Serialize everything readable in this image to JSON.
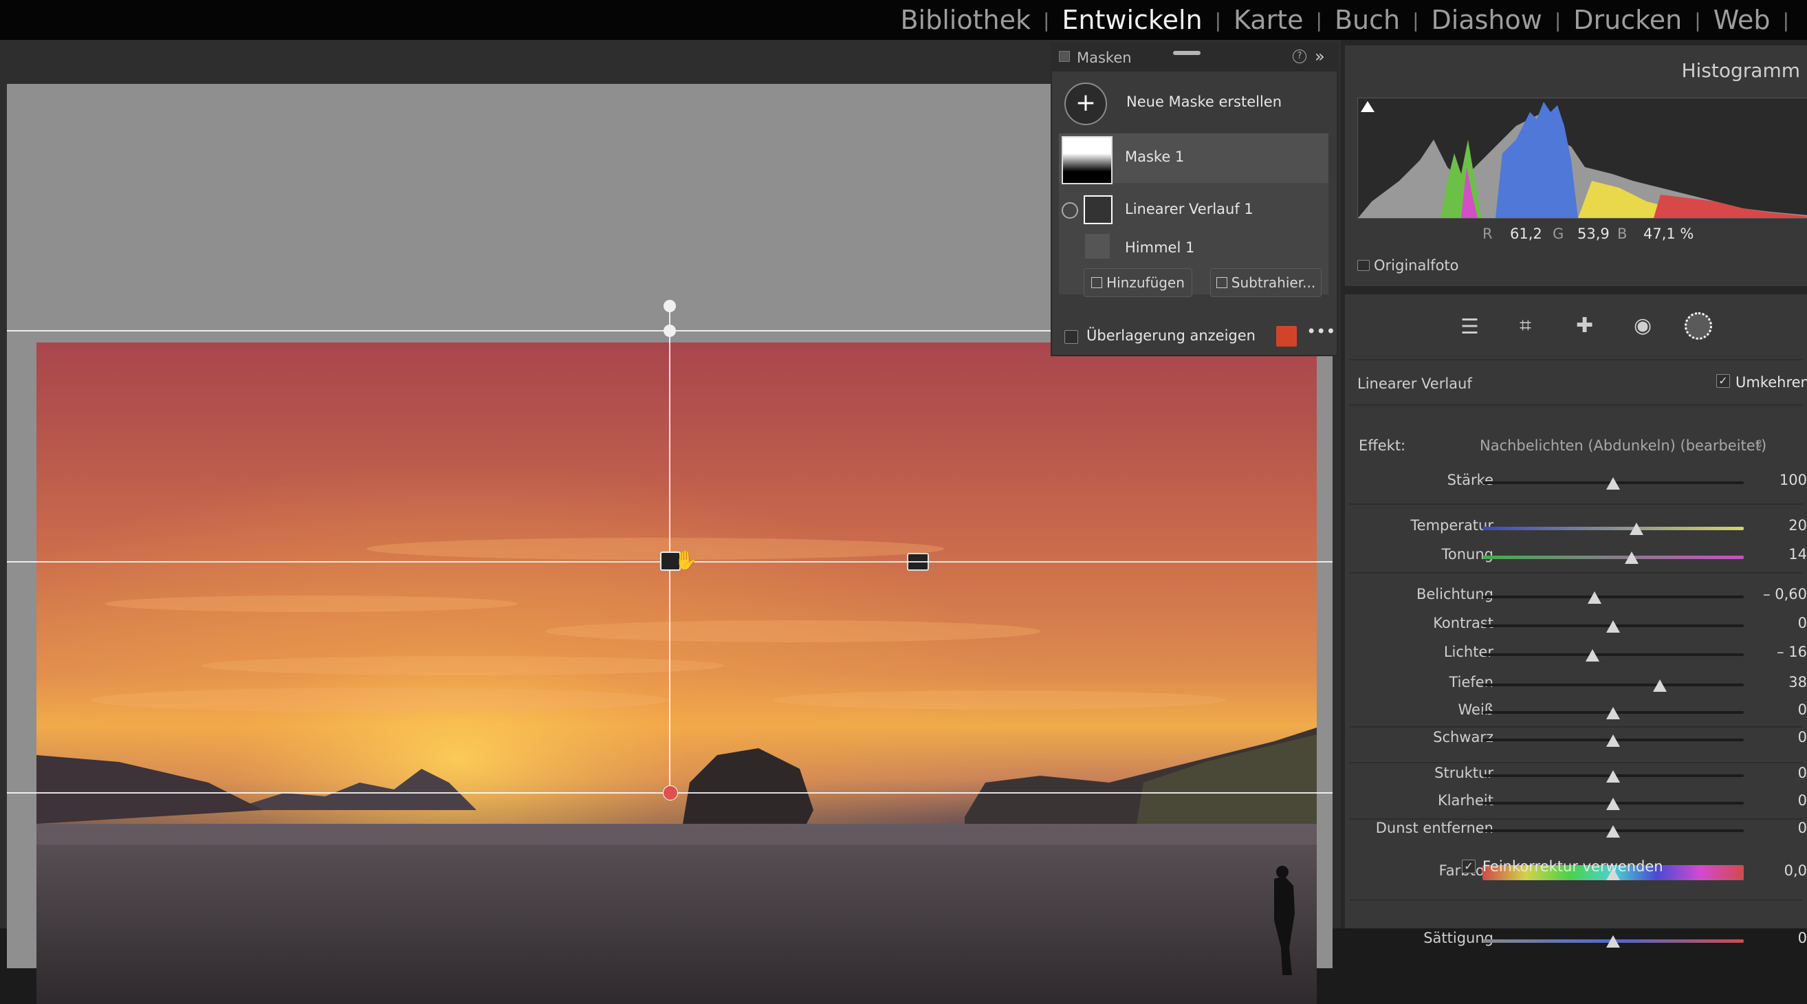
{
  "modules": [
    "Bibliothek",
    "Entwickeln",
    "Karte",
    "Buch",
    "Diashow",
    "Drucken",
    "Web"
  ],
  "active_module": "Entwickeln",
  "mask_panel": {
    "title": "Masken",
    "new_mask": "Neue Maske erstellen",
    "mask_name": "Maske 1",
    "component_1": "Linearer Verlauf 1",
    "component_2": "Himmel 1",
    "add_button": "Hinzufügen",
    "subtract_button": "Subtrahier...",
    "overlay_label": "Überlagerung anzeigen",
    "overlay_color": "#d2442a"
  },
  "histogram": {
    "title": "Histogramm",
    "r_label": "R",
    "r_value": "61,2",
    "g_label": "G",
    "g_value": "53,9",
    "b_label": "B",
    "b_value": "47,1 %",
    "original_label": "Originalfoto"
  },
  "tool_panel": {
    "section_title": "Linearer Verlauf",
    "invert_label": "Umkehren",
    "effect_label": "Effekt:",
    "effect_value": "Nachbelichten (Abdunkeln) (bearbeitet)",
    "fine_label": "Feinkorrektur verwenden"
  },
  "sliders": [
    {
      "label": "Stärke",
      "value": "100",
      "pos": 0.5
    },
    {
      "label": "Temperatur",
      "value": "20",
      "pos": 0.59
    },
    {
      "label": "Tonung",
      "value": "14",
      "pos": 0.57
    },
    {
      "label": "Belichtung",
      "value": "– 0,60",
      "pos": 0.43
    },
    {
      "label": "Kontrast",
      "value": "0",
      "pos": 0.5
    },
    {
      "label": "Lichter",
      "value": "– 16",
      "pos": 0.42
    },
    {
      "label": "Tiefen",
      "value": "38",
      "pos": 0.68
    },
    {
      "label": "Weiß",
      "value": "0",
      "pos": 0.5
    },
    {
      "label": "Schwarz",
      "value": "0",
      "pos": 0.5
    },
    {
      "label": "Struktur",
      "value": "0",
      "pos": 0.5
    },
    {
      "label": "Klarheit",
      "value": "0",
      "pos": 0.5
    },
    {
      "label": "Dunst entfernen",
      "value": "0",
      "pos": 0.5
    },
    {
      "label": "Farbton",
      "value": "0,0",
      "pos": 0.5
    },
    {
      "label": "Sättigung",
      "value": "0",
      "pos": 0.5
    }
  ]
}
